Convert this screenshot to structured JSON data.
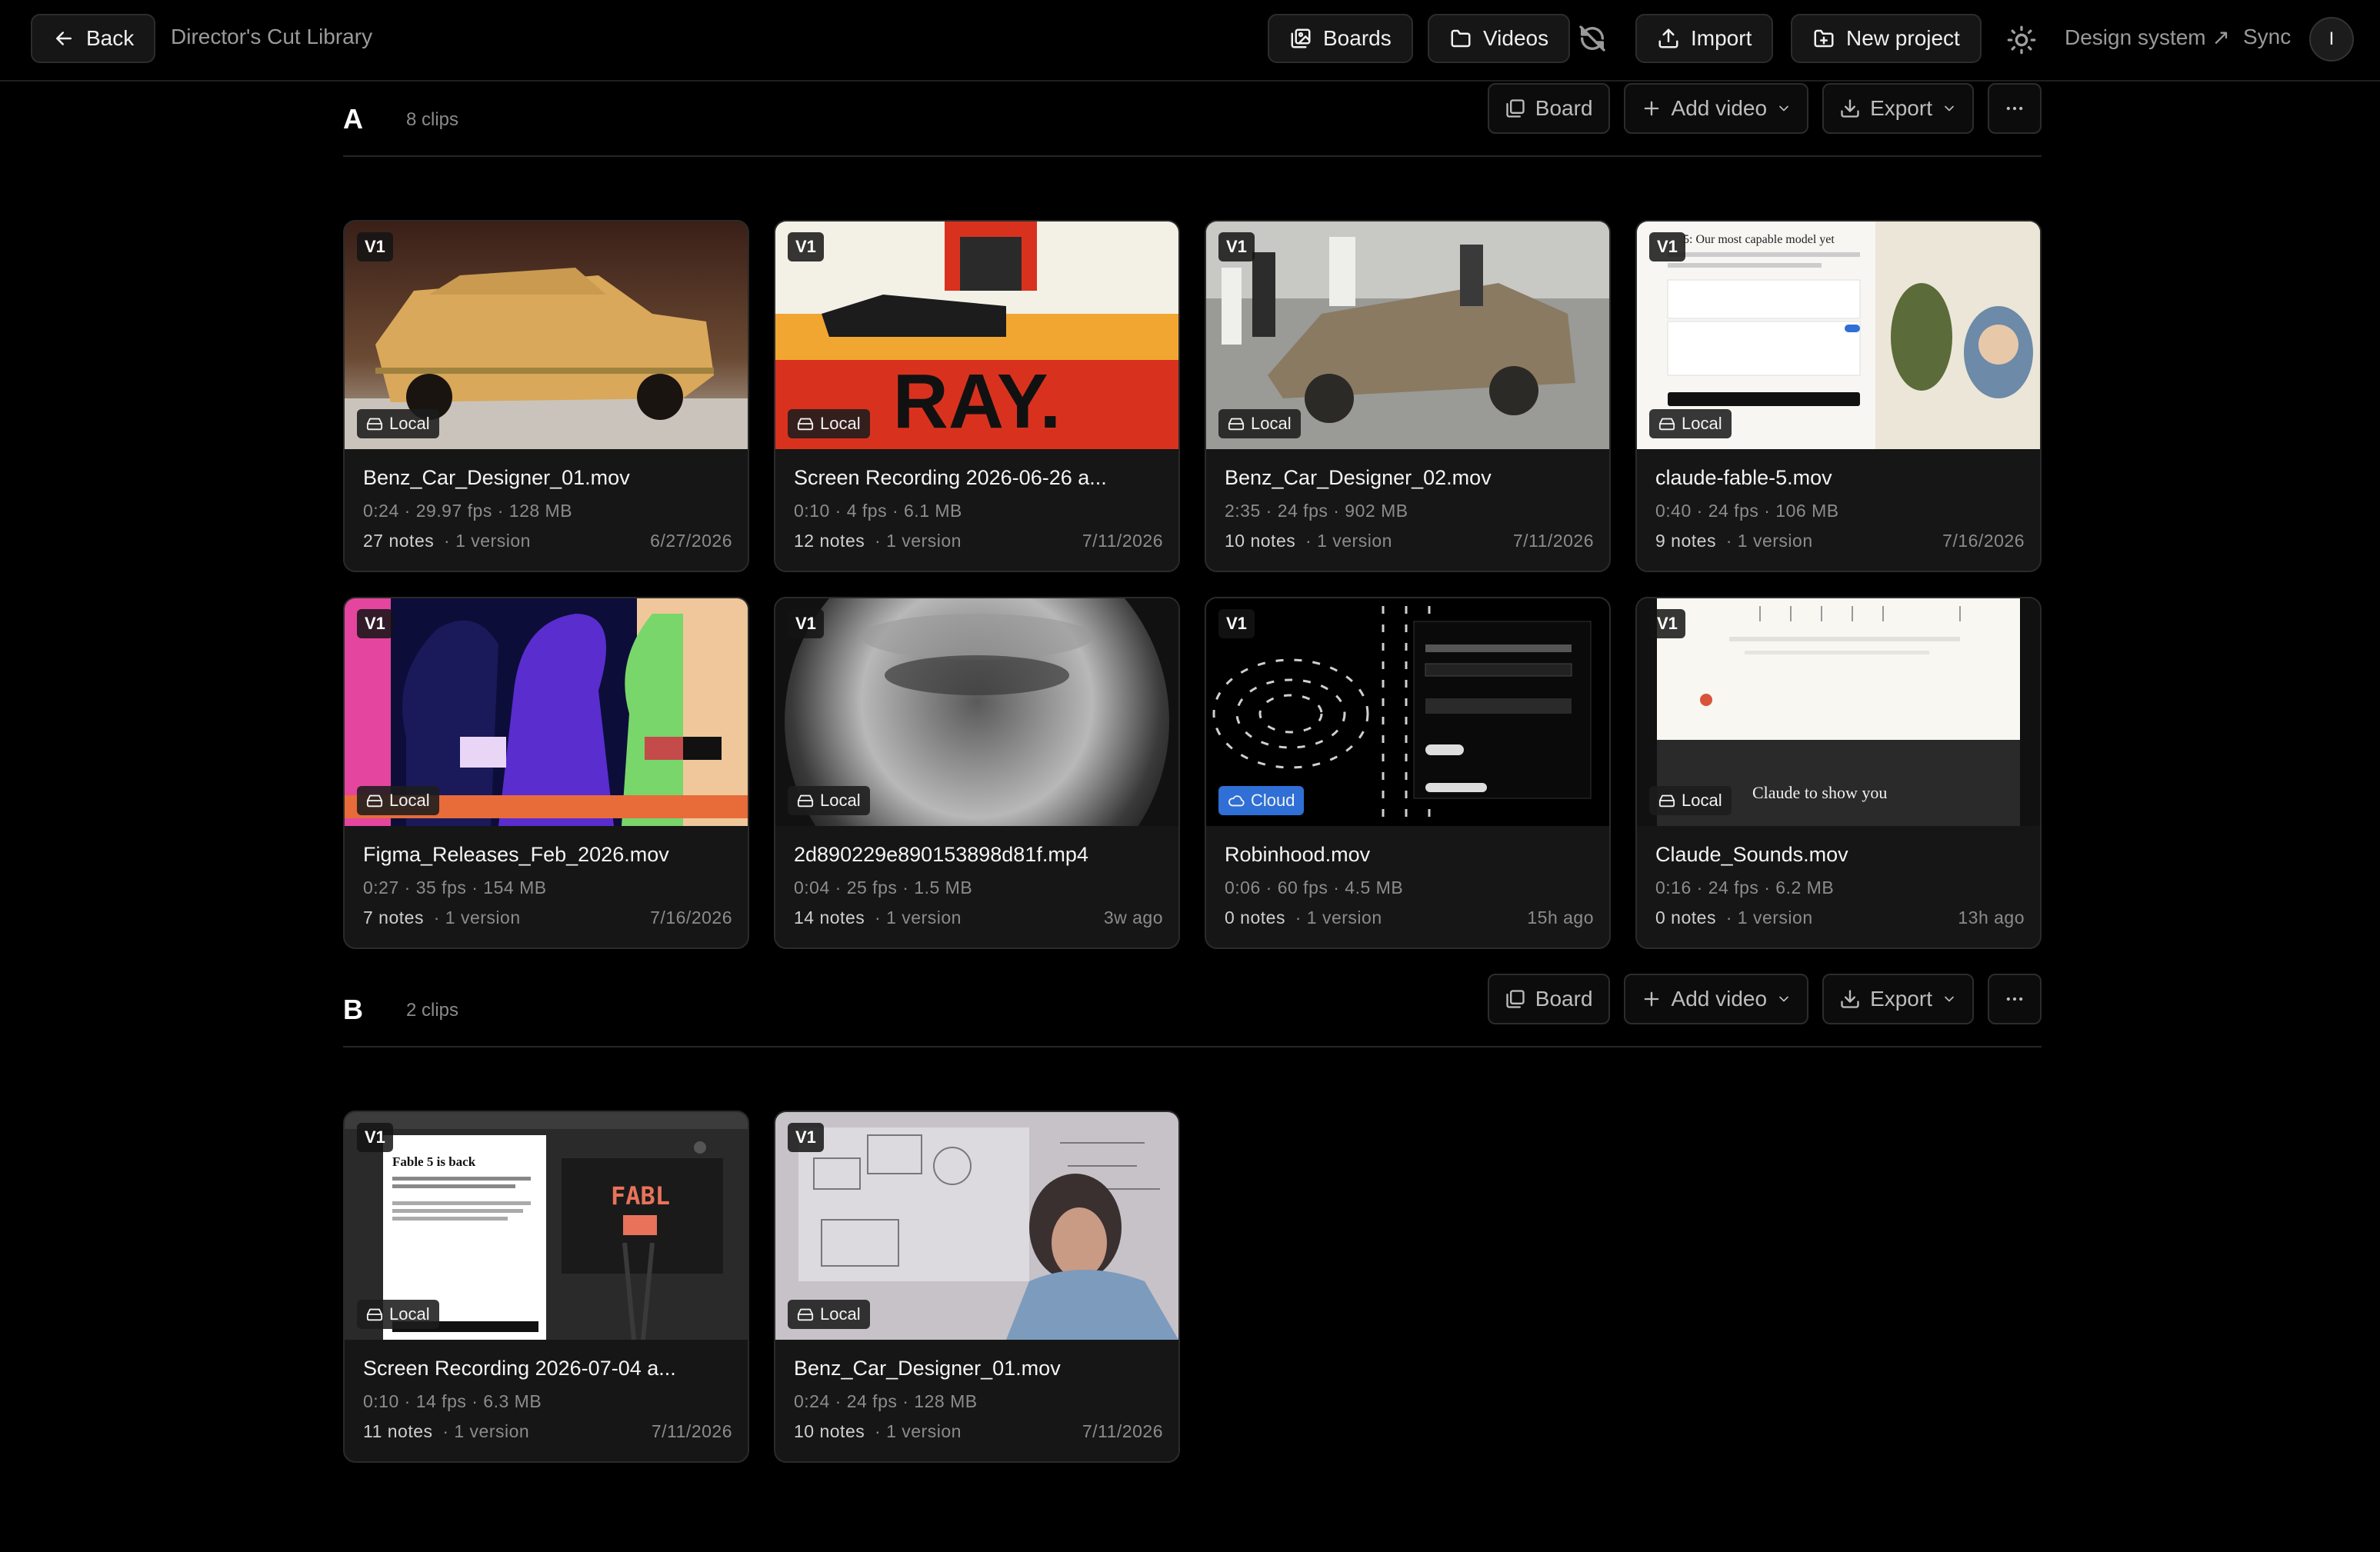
{
  "header": {
    "back_label": "Back",
    "breadcrumb": "Director's Cut Library",
    "boards_label": "Boards",
    "videos_label": "Videos",
    "import_label": "Import",
    "new_project_label": "New project",
    "design_system_label": "Design system ↗",
    "sync_label": "Sync",
    "avatar_initial": "I"
  },
  "sections": [
    {
      "letter": "A",
      "count": "8 clips",
      "board_label": "Board",
      "add_video_label": "Add video",
      "export_label": "Export",
      "clips": [
        {
          "version": "V1",
          "storage": "Local",
          "name": "Benz_Car_Designer_01.mov",
          "meta": "0:24 · 29.97 fps · 128 MB",
          "notes": "27 notes",
          "versions": "· 1 version",
          "date": "6/27/2026"
        },
        {
          "version": "V1",
          "storage": "Local",
          "name": "Screen Recording 2026-06-26 a...",
          "meta": "0:10 · 4 fps · 6.1 MB",
          "notes": "12 notes",
          "versions": "· 1 version",
          "date": "7/11/2026"
        },
        {
          "version": "V1",
          "storage": "Local",
          "name": "Benz_Car_Designer_02.mov",
          "meta": "2:35 · 24 fps · 902 MB",
          "notes": "10 notes",
          "versions": "· 1 version",
          "date": "7/11/2026"
        },
        {
          "version": "V1",
          "storage": "Local",
          "name": "claude-fable-5.mov",
          "meta": "0:40 · 24 fps · 106 MB",
          "notes": "9 notes",
          "versions": "· 1 version",
          "date": "7/16/2026"
        },
        {
          "version": "V1",
          "storage": "Local",
          "name": "Figma_Releases_Feb_2026.mov",
          "meta": "0:27 · 35 fps · 154 MB",
          "notes": "7 notes",
          "versions": "· 1 version",
          "date": "7/16/2026"
        },
        {
          "version": "V1",
          "storage": "Local",
          "name": "2d890229e890153898d81f.mp4",
          "meta": "0:04 · 25 fps · 1.5 MB",
          "notes": "14 notes",
          "versions": "· 1 version",
          "date": "3w ago"
        },
        {
          "version": "V1",
          "storage": "Cloud",
          "name": "Robinhood.mov",
          "meta": "0:06 · 60 fps · 4.5 MB",
          "notes": "0 notes",
          "versions": "· 1 version",
          "date": "15h ago"
        },
        {
          "version": "V1",
          "storage": "Local",
          "name": "Claude_Sounds.mov",
          "meta": "0:16 · 24 fps · 6.2 MB",
          "notes": "0 notes",
          "versions": "· 1 version",
          "date": "13h ago"
        }
      ]
    },
    {
      "letter": "B",
      "count": "2 clips",
      "board_label": "Board",
      "add_video_label": "Add video",
      "export_label": "Export",
      "clips": [
        {
          "version": "V1",
          "storage": "Local",
          "name": "Screen Recording 2026-07-04 a...",
          "meta": "0:10 · 14 fps · 6.3 MB",
          "notes": "11 notes",
          "versions": "· 1 version",
          "date": "7/11/2026"
        },
        {
          "version": "V1",
          "storage": "Local",
          "name": "Benz_Car_Designer_01.mov",
          "meta": "0:24 · 24 fps · 128 MB",
          "notes": "10 notes",
          "versions": "· 1 version",
          "date": "7/11/2026"
        }
      ]
    }
  ],
  "thumb_text": {
    "ray": "RAY.",
    "fable_title": "Fable 5 is back",
    "fabl": "FABL",
    "fable_heading": "5: Our most capable model yet",
    "claude_sounds": "Claude to show you"
  },
  "colors": {
    "cloud_badge": "#2f6fd6",
    "background": "#000000",
    "card": "#161616"
  }
}
